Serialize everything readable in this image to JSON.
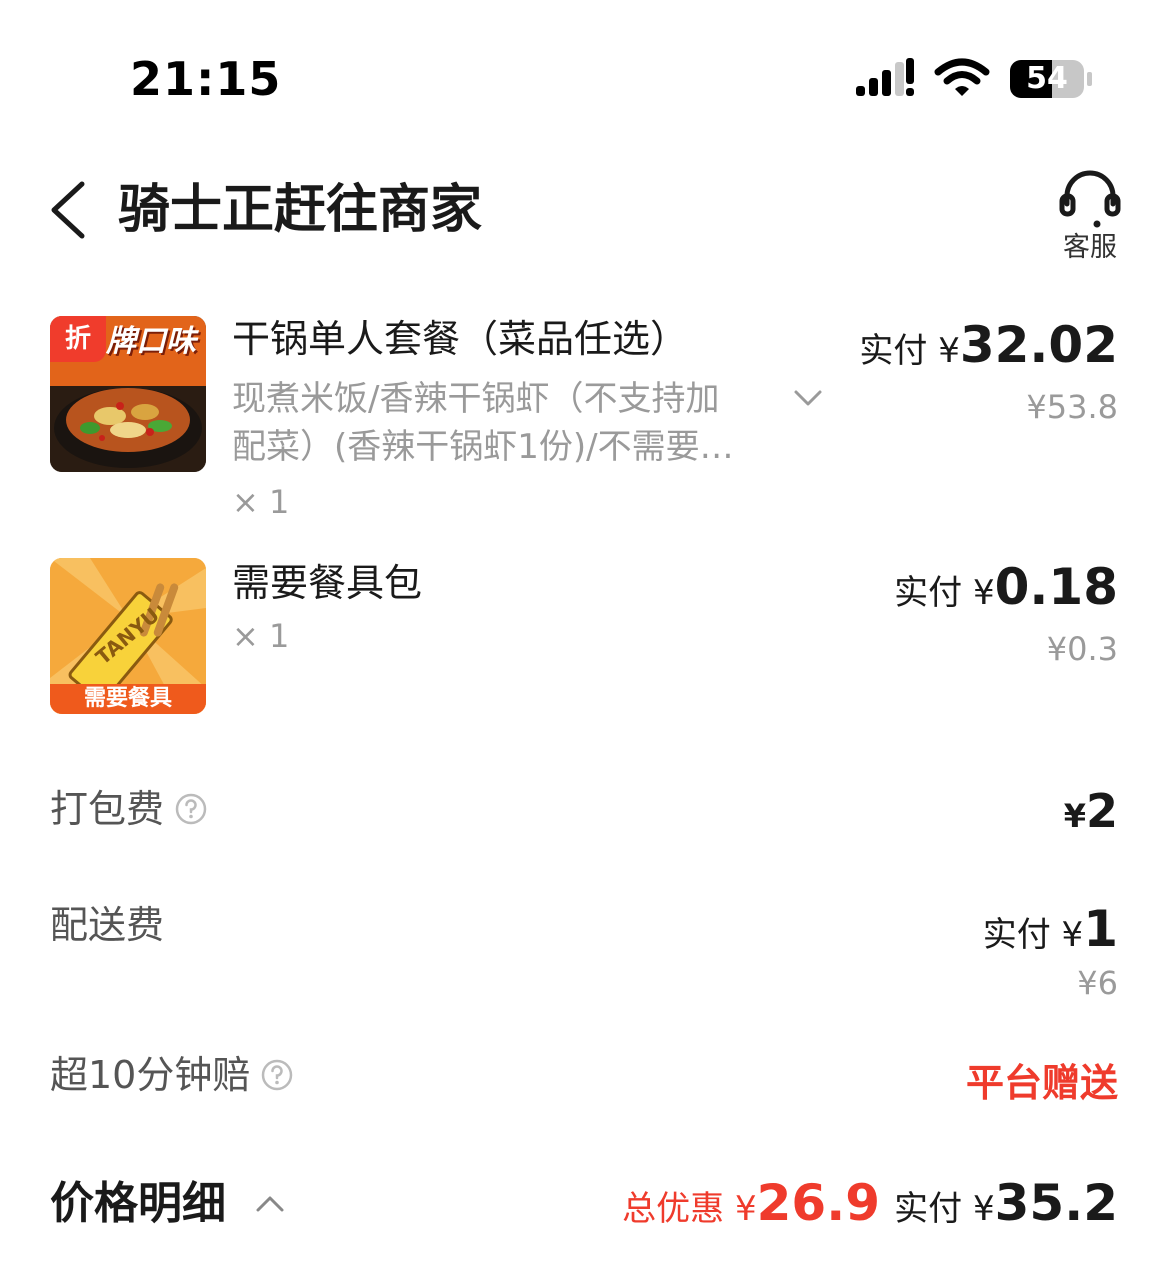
{
  "status_bar": {
    "time": "21:15",
    "battery": "54"
  },
  "header": {
    "title": "骑士正赶往商家",
    "service_label": "客服"
  },
  "items": [
    {
      "badge": "折",
      "thumb_text": "牌口味",
      "name": "干锅单人套餐（菜品任选）",
      "spec_line1": "现煮米饭/香辣干锅虾（不支持加",
      "spec_line2": "配菜）(香辣干锅虾1份)/不需要…",
      "qty": "× 1",
      "paid_label": "实付 ¥",
      "paid_value": "32.02",
      "original_price": "¥53.8"
    },
    {
      "thumb_brand": "TANYU",
      "thumb_caption": "需要餐具",
      "name": "需要餐具包",
      "qty": "× 1",
      "paid_label": "实付 ¥",
      "paid_value": "0.18",
      "original_price": "¥0.3"
    }
  ],
  "fees": {
    "packing": {
      "label": "打包费",
      "yen": "¥",
      "value": "2"
    },
    "delivery": {
      "label": "配送费",
      "paid_label": "实付 ¥",
      "value": "1",
      "original_price": "¥6"
    },
    "guarantee": {
      "label": "超10分钟赔",
      "value": "平台赠送"
    }
  },
  "price_detail": {
    "title": "价格明细",
    "discount_label": "总优惠 ¥",
    "discount_value": "26.9",
    "total_label": "实付 ¥",
    "total_value": "35.2"
  },
  "colors": {
    "accent_red": "#ef3b2c",
    "muted_text": "#9a9a9a",
    "primary_text": "#1a1a1a"
  }
}
